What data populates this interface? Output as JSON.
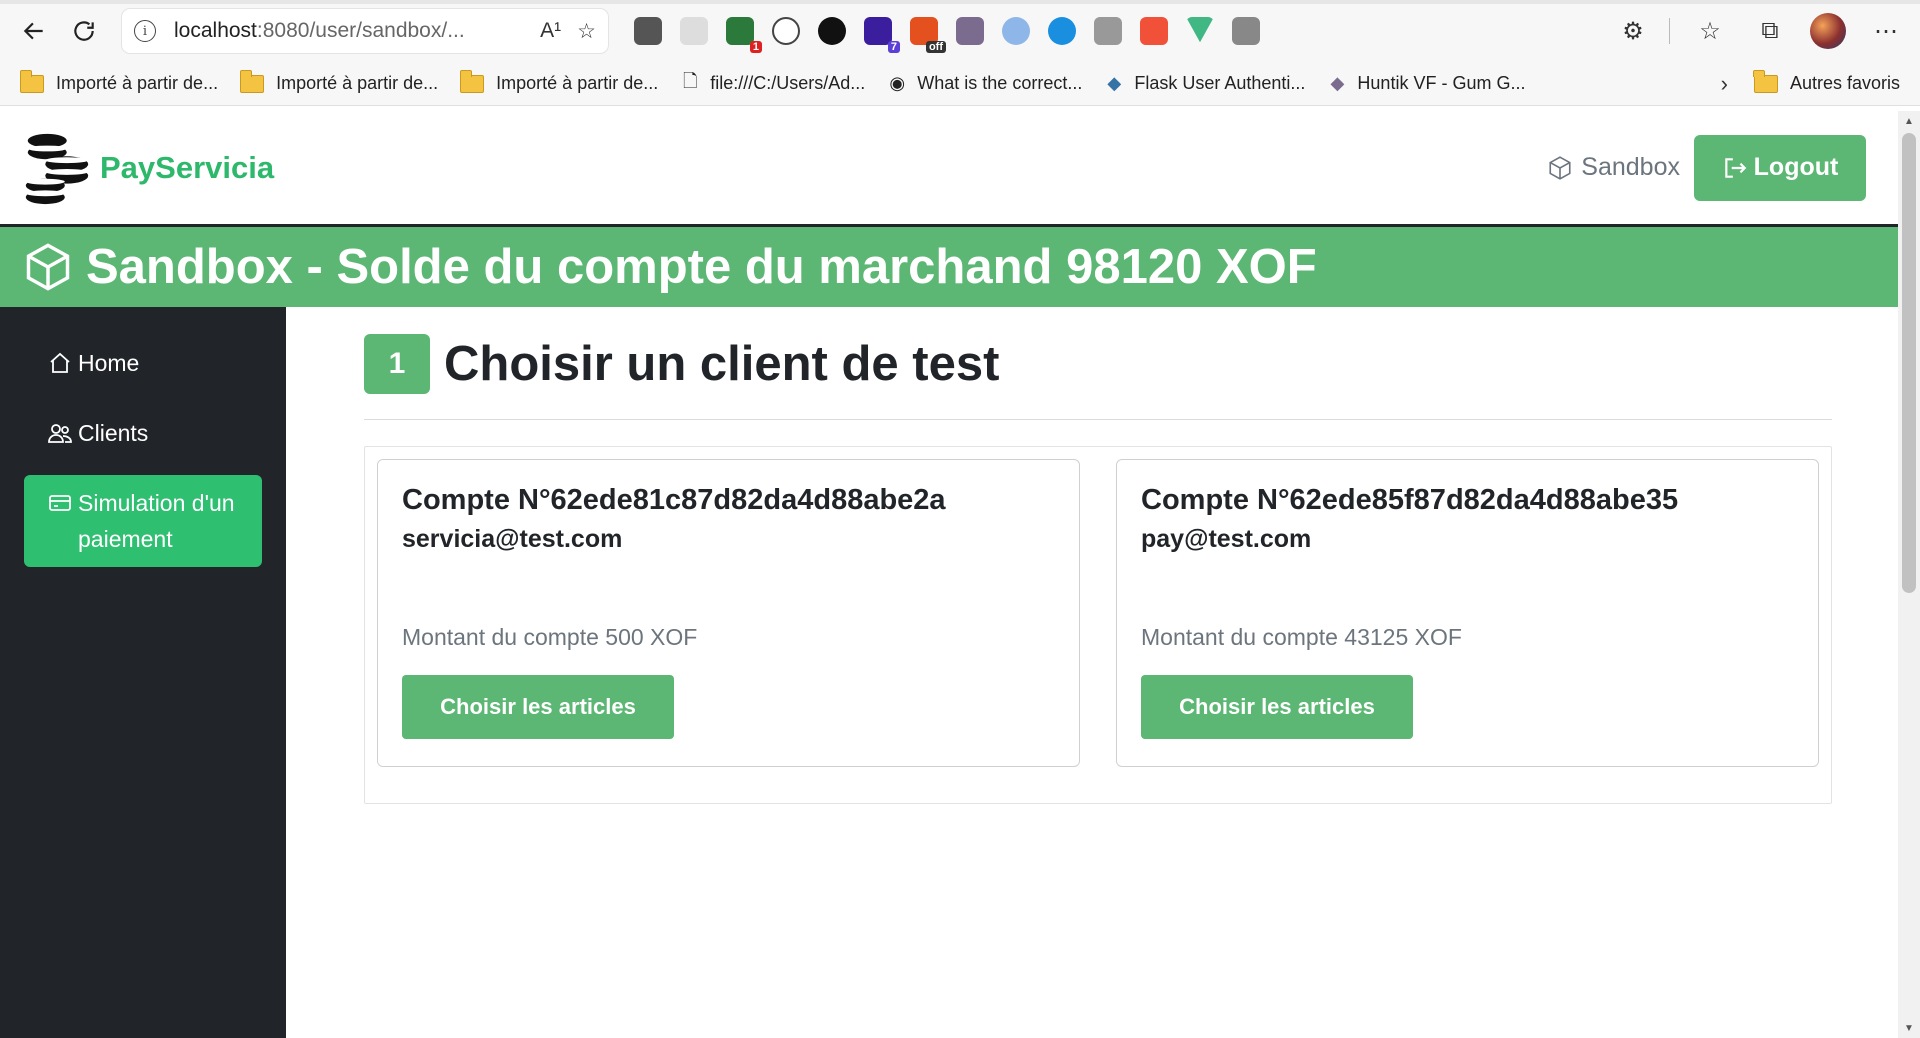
{
  "browser": {
    "url_main": "localhost",
    "url_rest": ":8080/user/sandbox/...",
    "read_aloud_label": "A¹",
    "bookmarks": [
      {
        "label": "Importé à partir de...",
        "icon": "folder-icon"
      },
      {
        "label": "Importé à partir de...",
        "icon": "folder-icon"
      },
      {
        "label": "Importé à partir de...",
        "icon": "folder-icon"
      },
      {
        "label": "file:///C:/Users/Ad...",
        "icon": "file-icon"
      },
      {
        "label": "What is the correct...",
        "icon": "site-icon"
      },
      {
        "label": "Flask User Authenti...",
        "icon": "python-icon"
      },
      {
        "label": "Huntik VF - Gum G...",
        "icon": "site-icon"
      }
    ],
    "other_favorites": "Autres favoris",
    "ext_badges": {
      "tabs": "1",
      "seven": "7",
      "off": "off"
    }
  },
  "header": {
    "brand": "PayServicia",
    "sandbox_label": "Sandbox",
    "logout_label": "Logout"
  },
  "banner": {
    "title": "Sandbox - Solde du compte du marchand 98120 XOF"
  },
  "sidebar": {
    "items": [
      {
        "label": "Home",
        "icon": "house-icon"
      },
      {
        "label": "Clients",
        "icon": "people-icon"
      },
      {
        "label": "Simulation d'un paiement",
        "icon": "credit-card-icon",
        "active": true
      }
    ]
  },
  "main": {
    "step_number": "1",
    "step_title": "Choisir un client de test",
    "cards": [
      {
        "title": "Compte N°62ede81c87d82da4d88abe2a",
        "email": "servicia@test.com",
        "amount": "Montant du compte 500 XOF",
        "button": "Choisir les articles"
      },
      {
        "title": "Compte N°62ede85f87d82da4d88abe35",
        "email": "pay@test.com",
        "amount": "Montant du compte 43125 XOF",
        "button": "Choisir les articles"
      }
    ]
  },
  "colors": {
    "accent": "#5cb774",
    "brand": "#2db86b",
    "sidebar": "#212529",
    "active": "#2fbf71"
  }
}
